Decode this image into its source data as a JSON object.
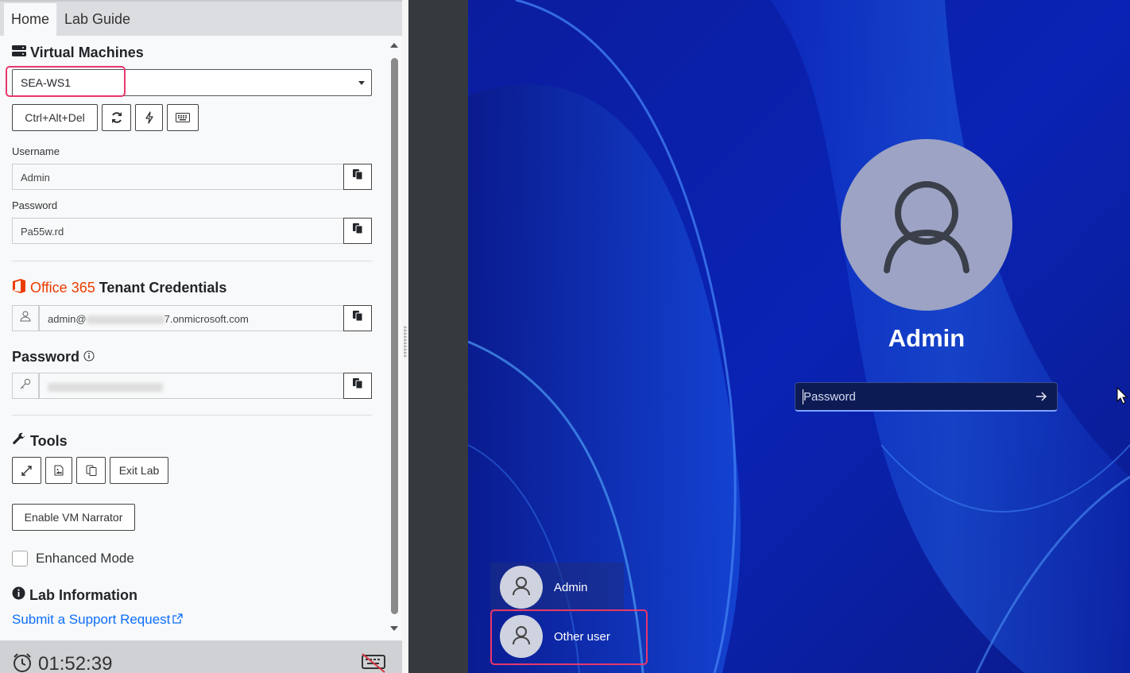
{
  "tabs": [
    {
      "label": "Home"
    },
    {
      "label": "Lab Guide"
    }
  ],
  "vm_section": {
    "title": "Virtual Machines",
    "selected_vm": "SEA-WS1",
    "ctrl_alt_del_label": "Ctrl+Alt+Del",
    "username_label": "Username",
    "username_value": "Admin",
    "password_label": "Password",
    "password_value": "Pa55w.rd"
  },
  "tenant": {
    "brand": "Office 365",
    "title": "Tenant Credentials",
    "email_prefix": "admin@",
    "email_suffix": "7.onmicrosoft.com",
    "password_label": "Password"
  },
  "tools": {
    "title": "Tools",
    "exit_label": "Exit Lab",
    "narrator_label": "Enable VM Narrator",
    "enhanced_label": "Enhanced Mode"
  },
  "lab_info": {
    "title": "Lab Information",
    "support_link": "Submit a Support Request"
  },
  "timer": "01:52:39",
  "vm_screen": {
    "username": "Admin",
    "password_placeholder": "Password",
    "users": [
      {
        "name": "Admin"
      },
      {
        "name": "Other user"
      }
    ]
  },
  "colors": {
    "accent_link": "#0d6efd",
    "office_orange": "#eb3c00",
    "highlight": "#e8386b",
    "vm_background": "#0a1fa8"
  }
}
